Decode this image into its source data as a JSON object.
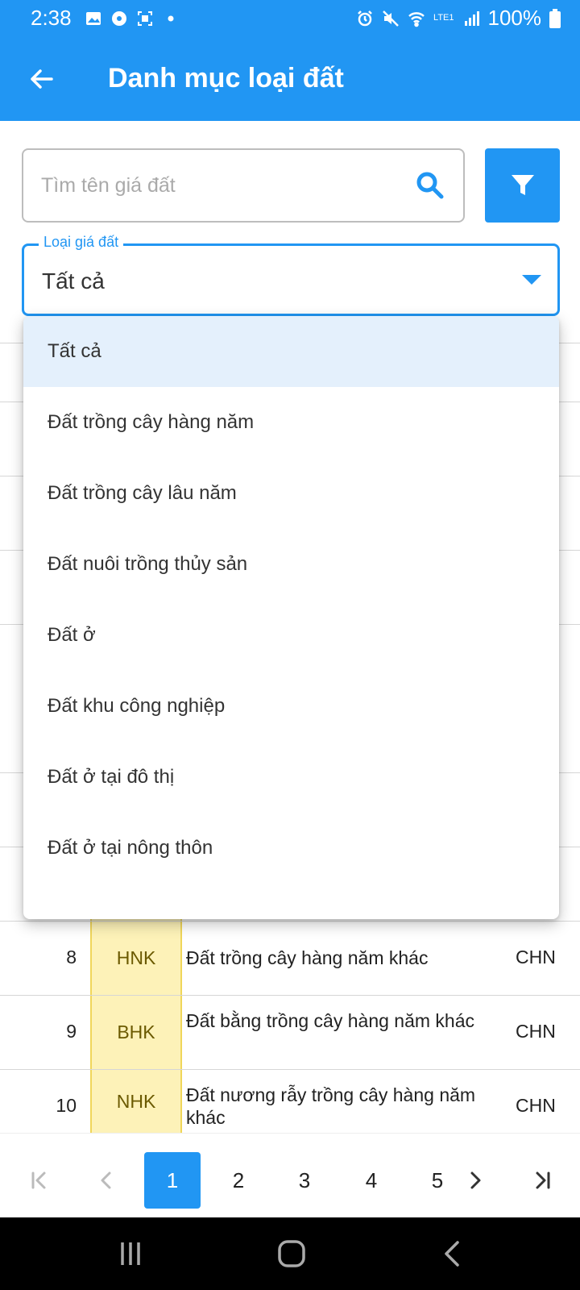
{
  "status_bar": {
    "time": "2:38",
    "battery": "100%",
    "network": "LTE1"
  },
  "app_bar": {
    "title": "Danh mục loại đất"
  },
  "search": {
    "placeholder": "Tìm tên giá đất"
  },
  "select": {
    "label": "Loại giá đất",
    "value": "Tất cả"
  },
  "dropdown": {
    "options": [
      "Tất cả",
      "Đất trồng cây hàng năm",
      "Đất trồng cây lâu năm",
      "Đất nuôi trồng thủy sản",
      "Đất ở",
      "Đất khu công nghiệp",
      "Đất ở tại đô thị",
      "Đất ở tại nông thôn"
    ],
    "selected_index": 0
  },
  "table": {
    "rows": [
      {
        "stt": "8",
        "code": "HNK",
        "name": "Đất trồng cây hàng năm khác",
        "group": "CHN"
      },
      {
        "stt": "9",
        "code": "BHK",
        "name": "Đất bằng trồng cây hàng năm khác",
        "group": "CHN"
      },
      {
        "stt": "10",
        "code": "NHK",
        "name": "Đất nương rẫy trồng cây hàng năm khác",
        "group": "CHN"
      }
    ]
  },
  "pagination": {
    "pages": [
      "1",
      "2",
      "3",
      "4",
      "5"
    ],
    "current": "1"
  },
  "colors": {
    "primary": "#2196f3",
    "code_cell_bg": "#fdf2b8",
    "selected_option_bg": "#e4f0fc"
  },
  "icons": {
    "back": "arrow-left-icon",
    "search": "search-icon",
    "filter": "filter-icon",
    "first_page": "first-page-icon",
    "prev_page": "chevron-left-icon",
    "next_page": "chevron-right-icon",
    "last_page": "last-page-icon"
  }
}
